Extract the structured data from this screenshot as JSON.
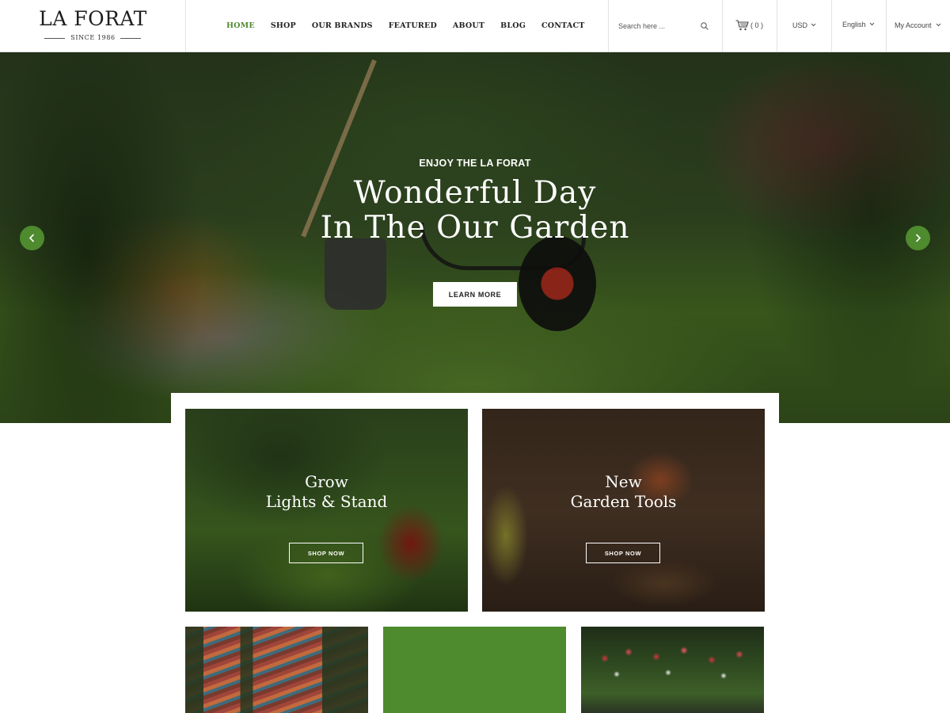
{
  "brand": {
    "name": "LA FORAT",
    "tagline": "SINCE 1986"
  },
  "nav": {
    "items": [
      {
        "label": "HOME",
        "active": true
      },
      {
        "label": "SHOP",
        "active": false
      },
      {
        "label": "OUR BRANDS",
        "active": false
      },
      {
        "label": "FEATURED",
        "active": false
      },
      {
        "label": "ABOUT",
        "active": false
      },
      {
        "label": "BLOG",
        "active": false
      },
      {
        "label": "CONTACT",
        "active": false
      }
    ]
  },
  "search": {
    "placeholder": "Search here ...",
    "value": "",
    "icon": "search-icon"
  },
  "cart": {
    "icon": "cart-icon",
    "count_label": "( 0 )"
  },
  "currency": {
    "selected": "USD"
  },
  "language": {
    "selected": "English"
  },
  "account": {
    "label": "My Account"
  },
  "hero": {
    "pretitle": "ENJOY THE LA FORAT",
    "title_line1": "Wonderful Day",
    "title_line2": "In The Our Garden",
    "button_label": "LEARN MORE",
    "prev_icon": "chevron-left-icon",
    "next_icon": "chevron-right-icon"
  },
  "banners": [
    {
      "title_line1": "Grow",
      "title_line2": "Lights & Stand",
      "button_label": "SHOP NOW"
    },
    {
      "title_line1": "New",
      "title_line2": "Garden Tools",
      "button_label": "SHOP NOW"
    }
  ],
  "colors": {
    "accent": "#4e8a2e",
    "text": "#222222",
    "border": "#e3e3e3",
    "white": "#ffffff"
  }
}
